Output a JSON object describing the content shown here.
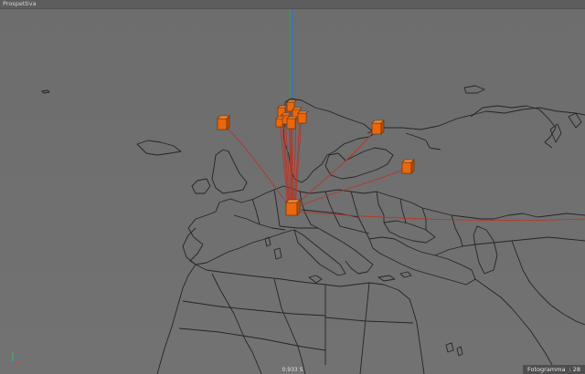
{
  "viewport": {
    "view_name": "Prospettiva",
    "timecode": "0.933 S",
    "frame_label": "Fotogramma",
    "frame_value": "28"
  },
  "colors": {
    "background": "#6f6f6f",
    "map_outline": "#252525",
    "node_fill": "#e8680e",
    "node_edge": "#6a2a00",
    "link": "#c03020",
    "y_axis": "#2f9f5f",
    "y_axis_2": "#3070d0"
  },
  "icons": [
    "axis-gizmo-icon"
  ]
}
